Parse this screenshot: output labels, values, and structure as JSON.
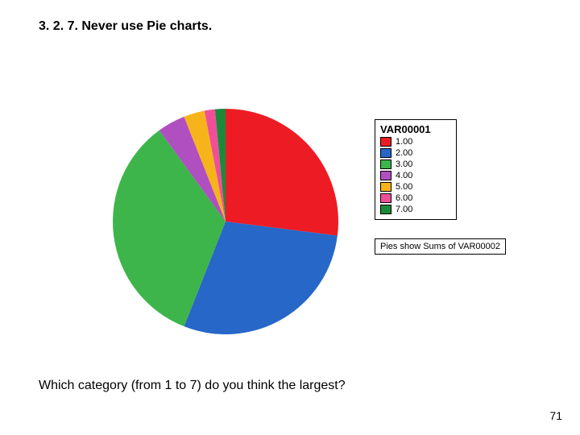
{
  "heading": "3. 2. 7. Never use Pie charts.",
  "question": "Which category (from 1 to 7) do you think the largest?",
  "page_number": "71",
  "legend_title": "VAR00001",
  "legend_note": "Pies show Sums of VAR00002",
  "legend": [
    {
      "label": "1.00",
      "color": "#ed1c24"
    },
    {
      "label": "2.00",
      "color": "#2767c8"
    },
    {
      "label": "3.00",
      "color": "#3db54a"
    },
    {
      "label": "4.00",
      "color": "#b04fc0"
    },
    {
      "label": "5.00",
      "color": "#f6b41a"
    },
    {
      "label": "6.00",
      "color": "#f04e98"
    },
    {
      "label": "7.00",
      "color": "#1a8a3a"
    }
  ],
  "chart_data": {
    "type": "pie",
    "title": "",
    "series_name": "VAR00001",
    "value_label": "Sums of VAR00002",
    "categories": [
      "1.00",
      "2.00",
      "3.00",
      "4.00",
      "5.00",
      "6.00",
      "7.00"
    ],
    "values": [
      27,
      29,
      34,
      4,
      3,
      1.5,
      1.5
    ],
    "colors": [
      "#ed1c24",
      "#2767c8",
      "#3db54a",
      "#b04fc0",
      "#f6b41a",
      "#f04e98",
      "#1a8a3a"
    ],
    "start_angle_deg": 0
  }
}
